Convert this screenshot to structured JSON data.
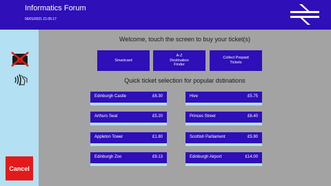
{
  "header": {
    "station": "Informatics Forum",
    "datetime": "06/01/2021 21:05:17",
    "logo_icon": "national-rail-double-arrow-icon"
  },
  "sidebar": {
    "cash_icon": "no-cash-icon",
    "contactless_icon": "contactless-payment-icon",
    "cancel_label": "Cancel"
  },
  "main": {
    "welcome": "Welcome, touch the screen to buy your ticket(s)",
    "options": [
      {
        "label": "Smartcard"
      },
      {
        "label": "A-Z\nDestination\nFinder"
      },
      {
        "label": "Collect Prepaid\nTickets"
      }
    ],
    "popular_heading": "Quick ticket selection for popular dstinations",
    "tickets": [
      {
        "name": "Edinburgh Castle",
        "price": "£6.30"
      },
      {
        "name": "Hive",
        "price": "£5.75"
      },
      {
        "name": "Arthurs Seat",
        "price": "£5.20"
      },
      {
        "name": "Princes Street",
        "price": "£6.40"
      },
      {
        "name": "Appleton Tower",
        "price": "£1.80"
      },
      {
        "name": "Scottish Parliament",
        "price": "£5.90"
      },
      {
        "name": "Edinburgh Zoo",
        "price": "£9.13"
      },
      {
        "name": "Edinburgh Airport",
        "price": "£14.00"
      }
    ]
  },
  "colors": {
    "brand_blue": "#2e0fb8",
    "sidebar_blue": "#b3e0f2",
    "background_grey": "#a3a3a3",
    "cancel_red": "#e41a1a"
  }
}
